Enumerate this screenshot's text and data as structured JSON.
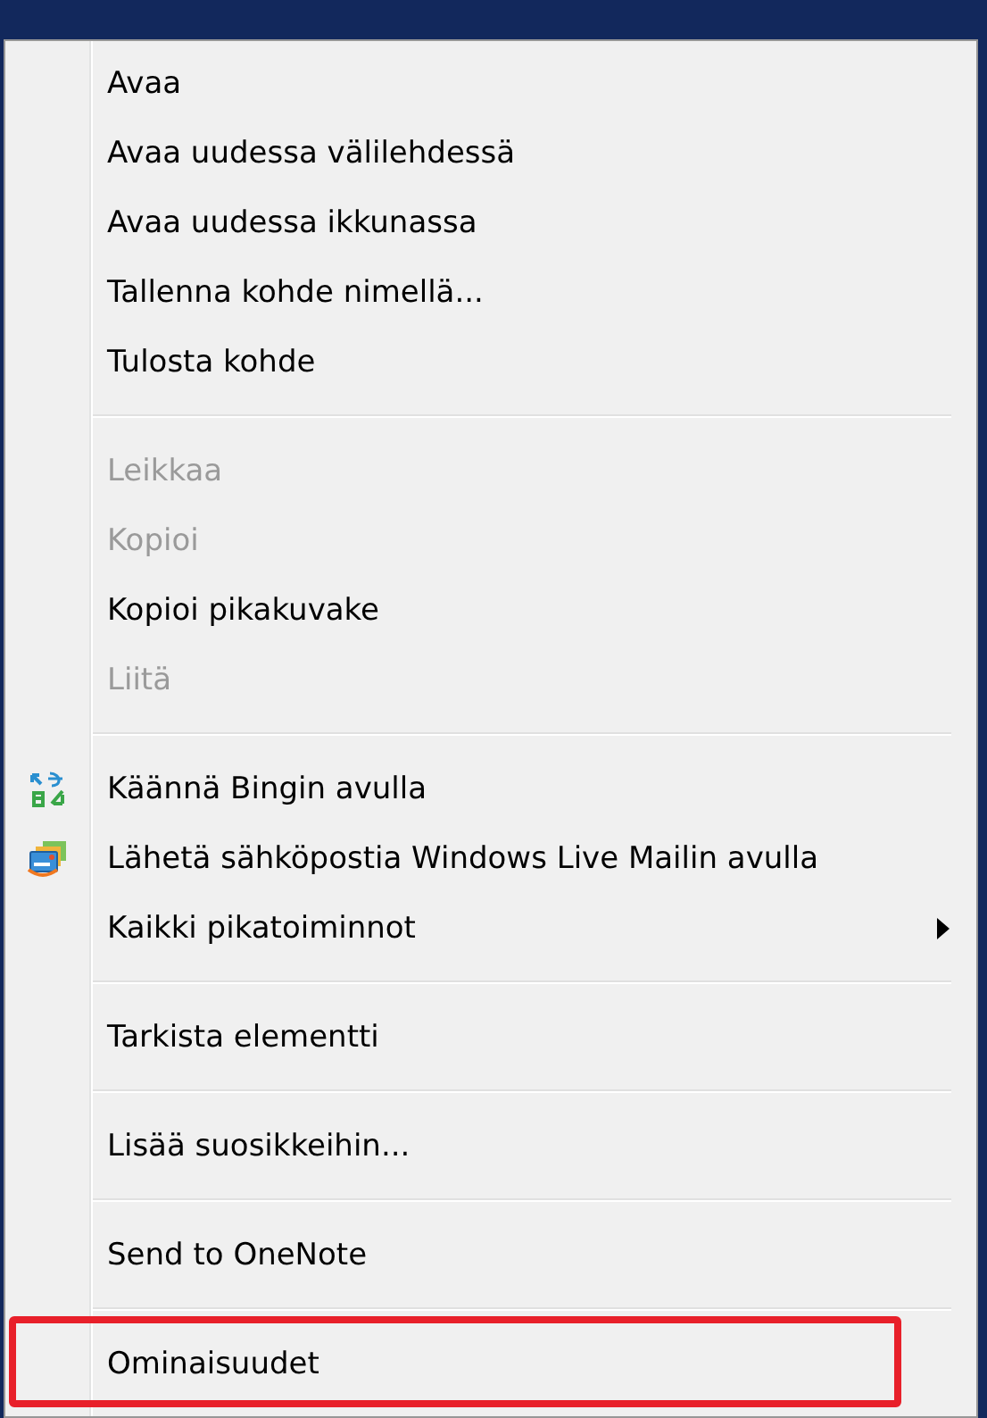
{
  "menu": {
    "groups": [
      {
        "items": [
          {
            "label": "Avaa",
            "disabled": false
          },
          {
            "label": "Avaa uudessa välilehdessä",
            "disabled": false
          },
          {
            "label": "Avaa uudessa ikkunassa",
            "disabled": false
          },
          {
            "label": "Tallenna kohde nimellä...",
            "disabled": false
          },
          {
            "label": "Tulosta kohde",
            "disabled": false
          }
        ]
      },
      {
        "items": [
          {
            "label": "Leikkaa",
            "disabled": true
          },
          {
            "label": "Kopioi",
            "disabled": true
          },
          {
            "label": "Kopioi pikakuvake",
            "disabled": false
          },
          {
            "label": "Liitä",
            "disabled": true
          }
        ]
      },
      {
        "items": [
          {
            "label": "Käännä Bingin avulla",
            "disabled": false,
            "kind": "translate"
          },
          {
            "label": "Lähetä sähköpostia Windows Live Mailin avulla",
            "disabled": false,
            "kind": "mail"
          },
          {
            "label": "Kaikki pikatoiminnot",
            "disabled": false,
            "submenu": true
          }
        ]
      },
      {
        "items": [
          {
            "label": "Tarkista elementti",
            "disabled": false
          }
        ]
      },
      {
        "items": [
          {
            "label": "Lisää suosikkeihin...",
            "disabled": false
          }
        ]
      },
      {
        "items": [
          {
            "label": "Send to OneNote",
            "disabled": false
          }
        ]
      },
      {
        "items": [
          {
            "label": "Ominaisuudet",
            "disabled": false,
            "highlighted": true
          }
        ]
      }
    ]
  }
}
